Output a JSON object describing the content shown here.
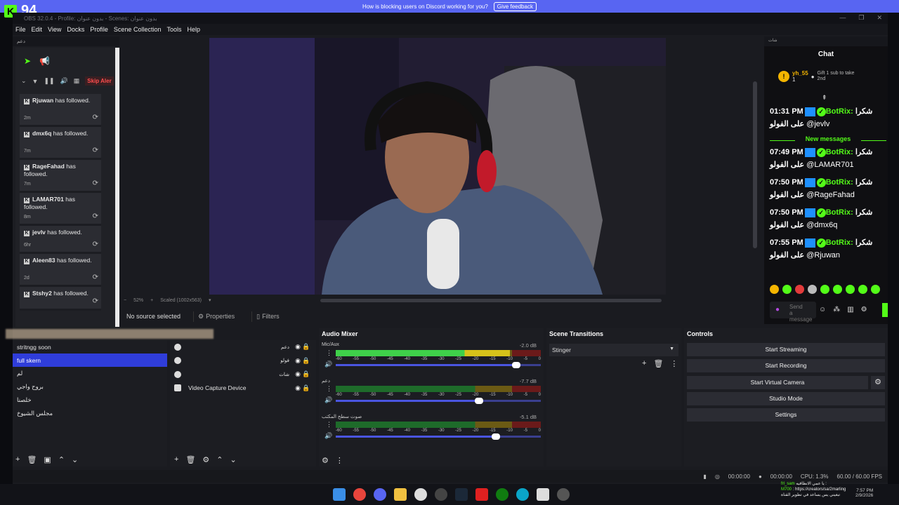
{
  "banner": {
    "text": "How is blocking users on Discord working for you?",
    "button": "Give feedback"
  },
  "overlay": {
    "viewer_count": "94"
  },
  "window": {
    "title": "OBS 32.0.4 - Profile: بدون عنوان - Scenes: بدون عنوان",
    "controls": [
      "—",
      "❐",
      "✕"
    ]
  },
  "menu": [
    "File",
    "Edit",
    "View",
    "Docks",
    "Profile",
    "Scene Collection",
    "Tools",
    "Help"
  ],
  "alerts": {
    "dock_title": "دعم",
    "skip_label": "Skip Aler",
    "items": [
      {
        "name": "Rjuwan",
        "text": "has followed.",
        "time": "2m"
      },
      {
        "name": "dmx6q",
        "text": "has followed.",
        "time": "7m"
      },
      {
        "name": "RageFahad",
        "text": "has followed.",
        "time": "7m"
      },
      {
        "name": "LAMAR701",
        "text": "has followed.",
        "time": "8m"
      },
      {
        "name": "jevlv",
        "text": "has followed.",
        "time": "6hr"
      },
      {
        "name": "Aleen83",
        "text": "has followed.",
        "time": "2d"
      },
      {
        "name": "Stshy2",
        "text": "has followed.",
        "time": "2d"
      }
    ]
  },
  "preview": {
    "zoom": "52%",
    "scaled": "Scaled (1002x563)",
    "no_source": "No source selected",
    "properties": "Properties",
    "filters": "Filters"
  },
  "chat": {
    "dock_title": "شات",
    "title": "Chat",
    "gift_user": "yh_55",
    "gift_rank": "1",
    "gift_text": "Gift 1 sub to take 2nd",
    "new_messages": "New messages",
    "messages": [
      {
        "time": "01:31 PM",
        "user": "BotRix:",
        "text": "شكرا",
        "line2": "على الفولو",
        "mention": "@jevlv"
      },
      {
        "time": "07:49 PM",
        "user": "BotRix:",
        "text": "شكرا",
        "line2": "على الفولو",
        "mention": "@LAMAR701"
      },
      {
        "time": "07:50 PM",
        "user": "BotRix:",
        "text": "شكرا",
        "line2": "على الفولو",
        "mention": "@RageFahad"
      },
      {
        "time": "07:50 PM",
        "user": "BotRix:",
        "text": "شكرا",
        "line2": "على الفولو",
        "mention": "@dmx6q"
      },
      {
        "time": "07:55 PM",
        "user": "BotRix:",
        "text": "شكرا",
        "line2": "على الفولو",
        "mention": "@Rjuwan"
      }
    ],
    "input_placeholder": "Send a message"
  },
  "scenes": {
    "items": [
      "stritngg soon",
      "full skern",
      "لم",
      "بروح واجي",
      "خلصنا",
      "مجلس الشيوخ"
    ],
    "selected_index": 1
  },
  "sources": {
    "items": [
      {
        "name": "دعم",
        "rtl": true
      },
      {
        "name": "فولو",
        "rtl": true
      },
      {
        "name": "شات",
        "rtl": true
      },
      {
        "name": "Video Capture Device",
        "rtl": false
      }
    ]
  },
  "mixer": {
    "title": "Audio Mixer",
    "ticks": [
      "-60",
      "-55",
      "-50",
      "-45",
      "-40",
      "-35",
      "-30",
      "-25",
      "-20",
      "-15",
      "-10",
      "-5",
      "0"
    ],
    "channels": [
      {
        "name": "Mic/Aux",
        "db": "-2.0 dB",
        "level": 0.85,
        "volume": 0.88
      },
      {
        "name": "دعم",
        "db": "-7.7 dB",
        "level": 0.0,
        "volume": 0.7
      },
      {
        "name": "صوت سطح المكتب",
        "db": "-5.1 dB",
        "level": 0.0,
        "volume": 0.78
      }
    ]
  },
  "transitions": {
    "title": "Scene Transitions",
    "selected": "Stinger"
  },
  "controls": {
    "title": "Controls",
    "buttons": [
      "Start Streaming",
      "Start Recording",
      "Start Virtual Camera",
      "Studio Mode",
      "Settings"
    ]
  },
  "status": {
    "stream_time": "00:00:00",
    "rec_time": "00:00:00",
    "cpu": "CPU: 1.3%",
    "fps": "60.00 / 60.00 FPS"
  },
  "tray": {
    "line1_user": "frl_sam",
    "line1_text": "يا عمي الانطاقيه :",
    "line2_user": "M700",
    "line2_text": ": https://creators/sa/2marling",
    "line3_text": "تبغيني يس يساعد في تطوير القناة",
    "time": "7:57 PM",
    "date": "2/9/2026"
  }
}
